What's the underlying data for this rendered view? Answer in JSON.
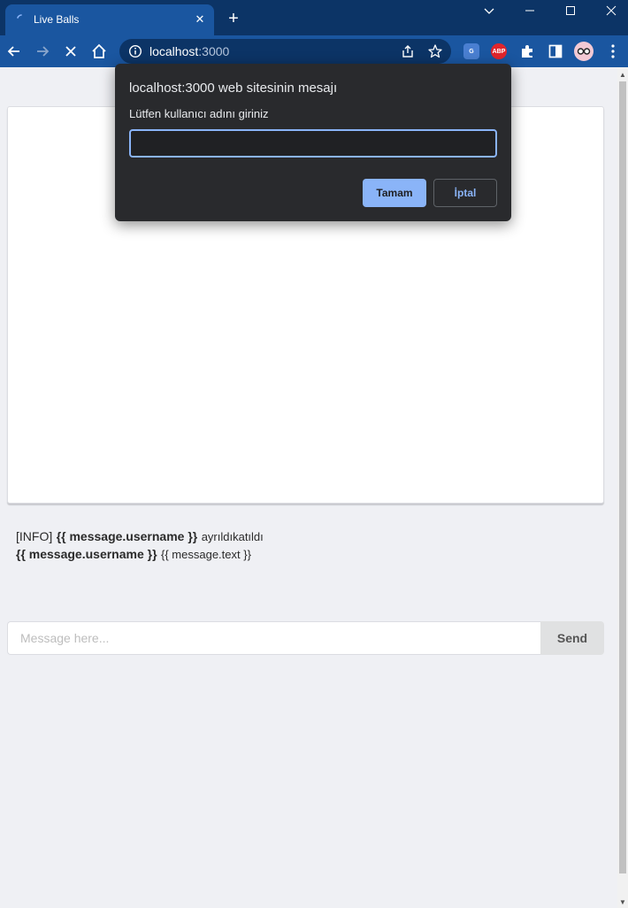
{
  "browser": {
    "tab_title": "Live Balls",
    "tab_close_glyph": "✕",
    "new_tab_glyph": "+",
    "url_host": "localhost",
    "url_port": ":3000",
    "extensions": [
      {
        "name": "translate-extension-icon",
        "label": "G"
      },
      {
        "name": "adblock-extension-icon",
        "label": "ABP"
      }
    ],
    "colors": {
      "titlebar": "#0c3466",
      "toolbar": "#1a56a0",
      "accent": "#8ab4f8"
    }
  },
  "page": {
    "messages": {
      "info_tag": "[INFO]",
      "info_username": "{{ message.username }}",
      "info_status": "ayrıldıkatıldı",
      "chat_username": "{{ message.username }}",
      "chat_text": "{{ message.text }}"
    },
    "chat": {
      "placeholder": "Message here...",
      "send_label": "Send"
    }
  },
  "dialog": {
    "title": "localhost:3000 web sitesinin mesajı",
    "label": "Lütfen kullanıcı adını giriniz",
    "input_value": "",
    "ok_label": "Tamam",
    "cancel_label": "İptal"
  }
}
